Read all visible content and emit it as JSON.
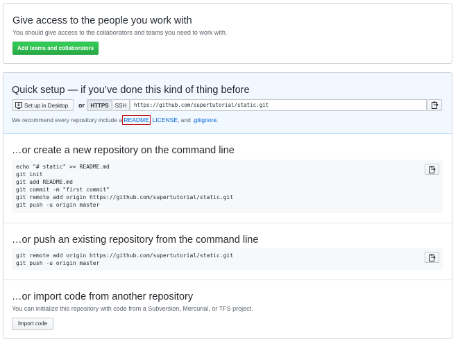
{
  "access": {
    "title": "Give access to the people you work with",
    "description": "You should give access to the collaborators and teams you need to work with.",
    "button": "Add teams and collaborators"
  },
  "quick_setup": {
    "title": "Quick setup — if you’ve done this kind of thing before",
    "desktop_button": "Set up in Desktop",
    "or": "or",
    "https": "HTTPS",
    "ssh": "SSH",
    "url": "https://github.com/supertutorial/static.git",
    "recommend_prefix": "We recommend every repository include a ",
    "readme": "README",
    "comma": ", ",
    "license": "LICENSE",
    "and": ", and ",
    "gitignore": ".gitignore",
    "period": "."
  },
  "create_section": {
    "title": "…or create a new repository on the command line",
    "code": "echo \"# static\" >> README.md\ngit init\ngit add README.md\ngit commit -m \"first commit\"\ngit remote add origin https://github.com/supertutorial/static.git\ngit push -u origin master"
  },
  "push_section": {
    "title": "…or push an existing repository from the command line",
    "code": "git remote add origin https://github.com/supertutorial/static.git\ngit push -u origin master"
  },
  "import_section": {
    "title": "…or import code from another repository",
    "description": "You can initialize this repository with code from a Subversion, Mercurial, or TFS project.",
    "button": "Import code"
  },
  "icons": {
    "clipboard": "clipboard-icon",
    "desktop": "desktop-download-icon"
  },
  "colors": {
    "green": "#28a745",
    "link": "#0366d6",
    "highlight": "#c2181b",
    "quick_bg": "#f1f8ff"
  }
}
